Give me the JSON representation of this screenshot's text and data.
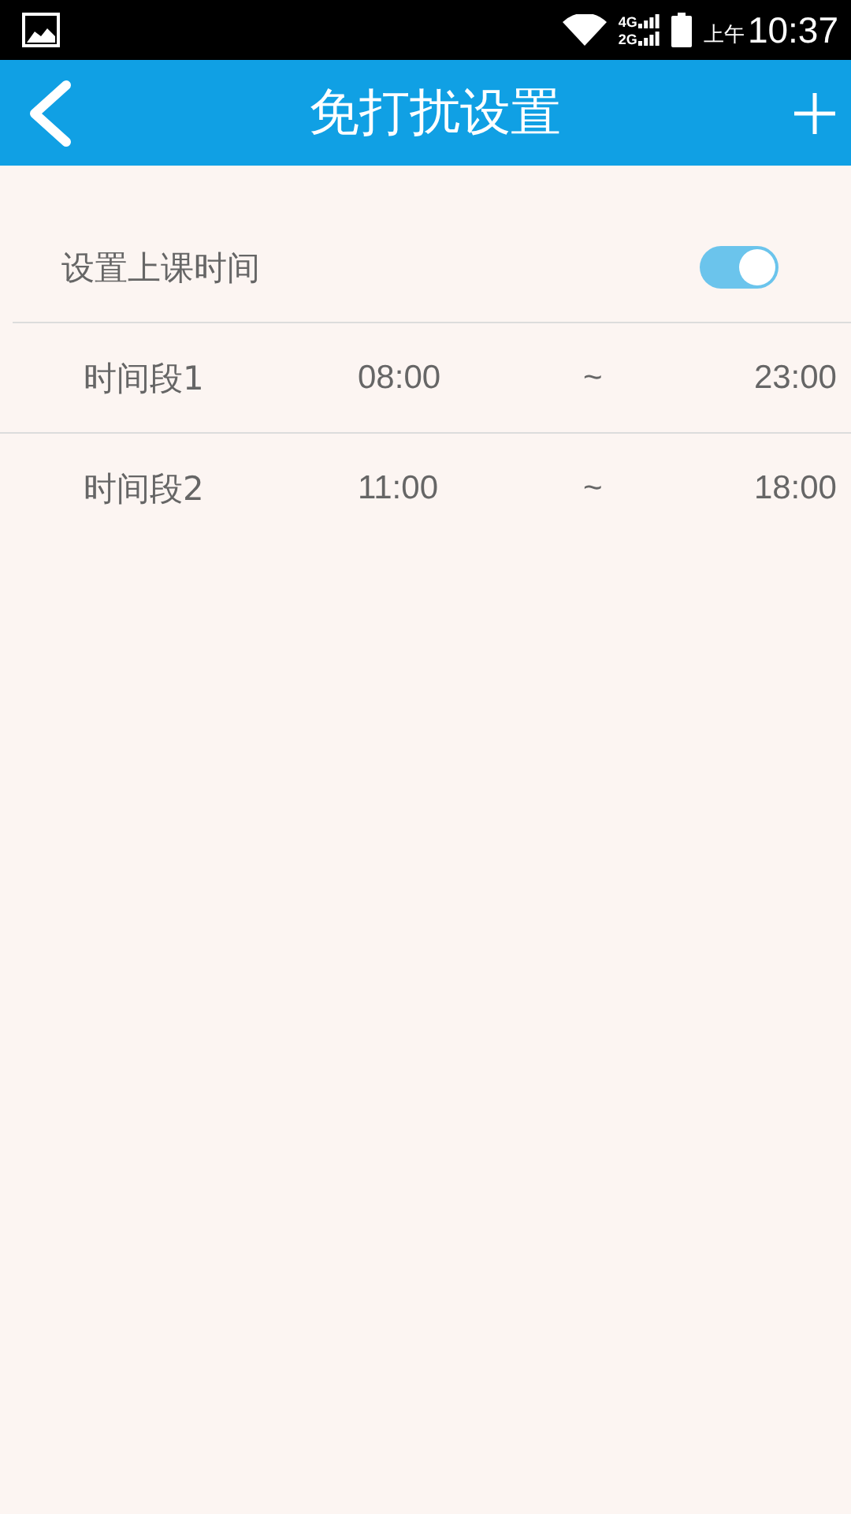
{
  "status_bar": {
    "network_top": "4G",
    "network_bottom": "2G",
    "period": "上午",
    "time": "10:37"
  },
  "app_bar": {
    "title": "免打扰设置"
  },
  "class_time": {
    "label": "设置上课时间",
    "on": true
  },
  "periods": [
    {
      "name": "时间段1",
      "start": "08:00",
      "separator": "~",
      "end": "23:00"
    },
    {
      "name": "时间段2",
      "start": "11:00",
      "separator": "~",
      "end": "18:00"
    }
  ]
}
